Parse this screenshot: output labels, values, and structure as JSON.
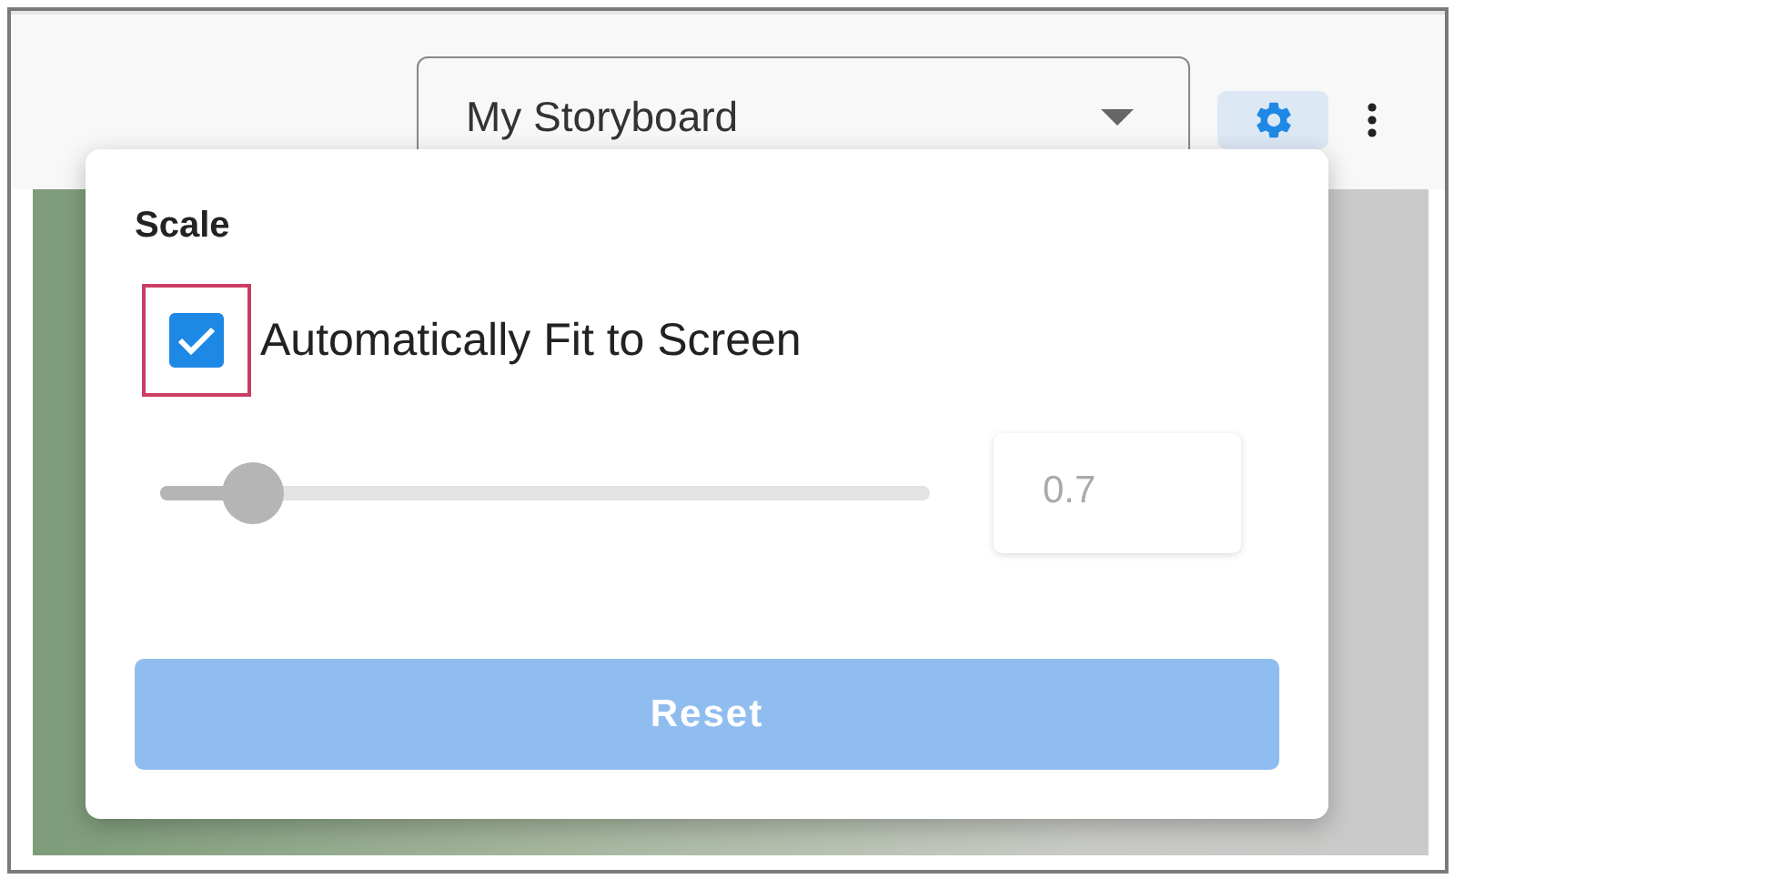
{
  "storyboard_select": {
    "value": "My Storyboard"
  },
  "toolbar": {
    "settings_selected": true
  },
  "settings_popover": {
    "title": "Scale",
    "auto_fit": {
      "label": "Automatically Fit to Screen",
      "checked": true,
      "focused": true
    },
    "scale_slider": {
      "level": 0.12,
      "disabled": true
    },
    "scale_value": {
      "value": "0.7",
      "disabled": true
    },
    "reset_button": {
      "label": "Reset",
      "disabled": true
    }
  }
}
